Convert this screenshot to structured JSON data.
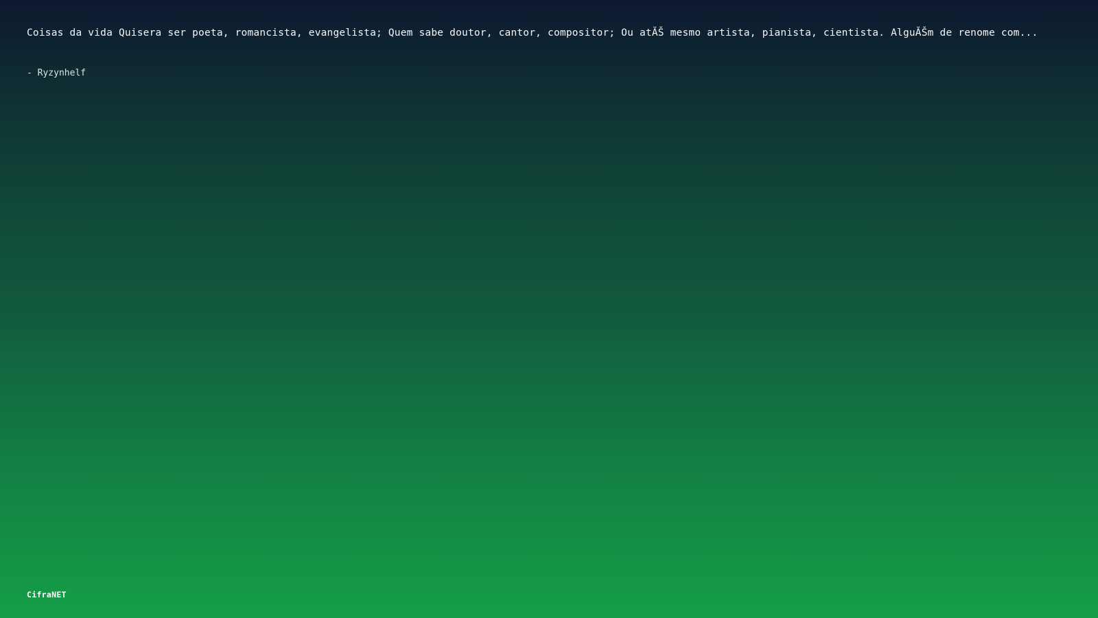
{
  "quote": {
    "text": "Coisas da vida Quisera ser poeta, romancista, evangelista; Quem sabe doutor, cantor, compositor; Ou atĂŠ mesmo artista, pianista, cientista. AlguĂŠm de renome com..."
  },
  "author": {
    "text": "- Ryzynhelf"
  },
  "brand": {
    "name": "CifraNET"
  },
  "colors": {
    "gradient_top": "#0e1830",
    "gradient_bottom": "#159e47",
    "text": "#ffffff"
  }
}
